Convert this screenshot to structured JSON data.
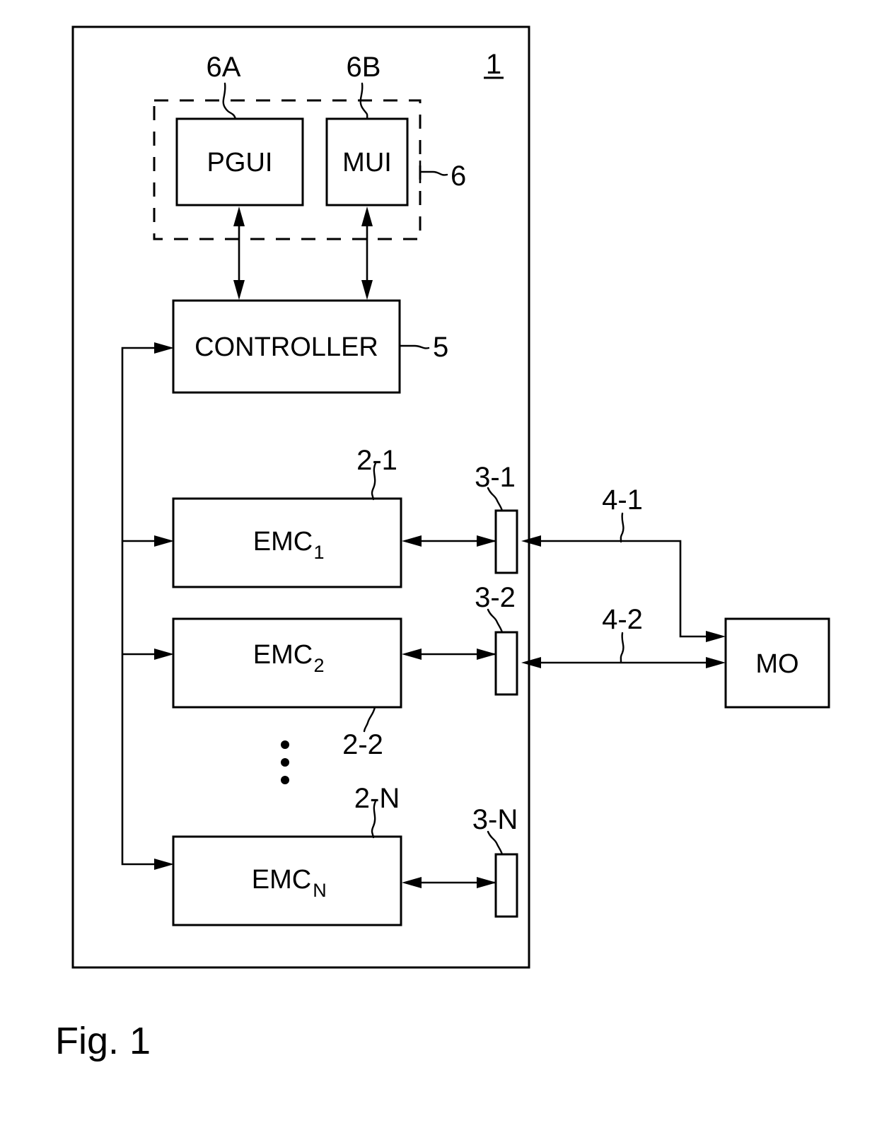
{
  "figure": {
    "caption": "Fig. 1",
    "system_ref": "1",
    "outer_box_name": "system-boundary"
  },
  "ui_group": {
    "ref": "6",
    "ref_a": "6A",
    "ref_b": "6B",
    "blocks": [
      {
        "id": "pgui",
        "label": "PGUI",
        "ref": "6A"
      },
      {
        "id": "mui",
        "label": "MUI",
        "ref": "6B"
      }
    ]
  },
  "controller": {
    "label": "CONTROLLER",
    "ref": "5"
  },
  "emc_units": [
    {
      "id": "emc1",
      "label": "EMC",
      "sub": "1",
      "ref": "2-1",
      "port_ref": "3-1"
    },
    {
      "id": "emc2",
      "label": "EMC",
      "sub": "2",
      "ref": "2-2",
      "port_ref": "3-2"
    },
    {
      "id": "emcn",
      "label": "EMC",
      "sub": "N",
      "ref": "2-N",
      "port_ref": "3-N"
    }
  ],
  "channels": [
    {
      "id": "ch1",
      "ref": "4-1"
    },
    {
      "id": "ch2",
      "ref": "4-2"
    }
  ],
  "measurement_object": {
    "label": "MO"
  },
  "ellipsis": {
    "glyph": "·"
  },
  "colors": {
    "stroke": "#000000",
    "background": "#ffffff"
  }
}
